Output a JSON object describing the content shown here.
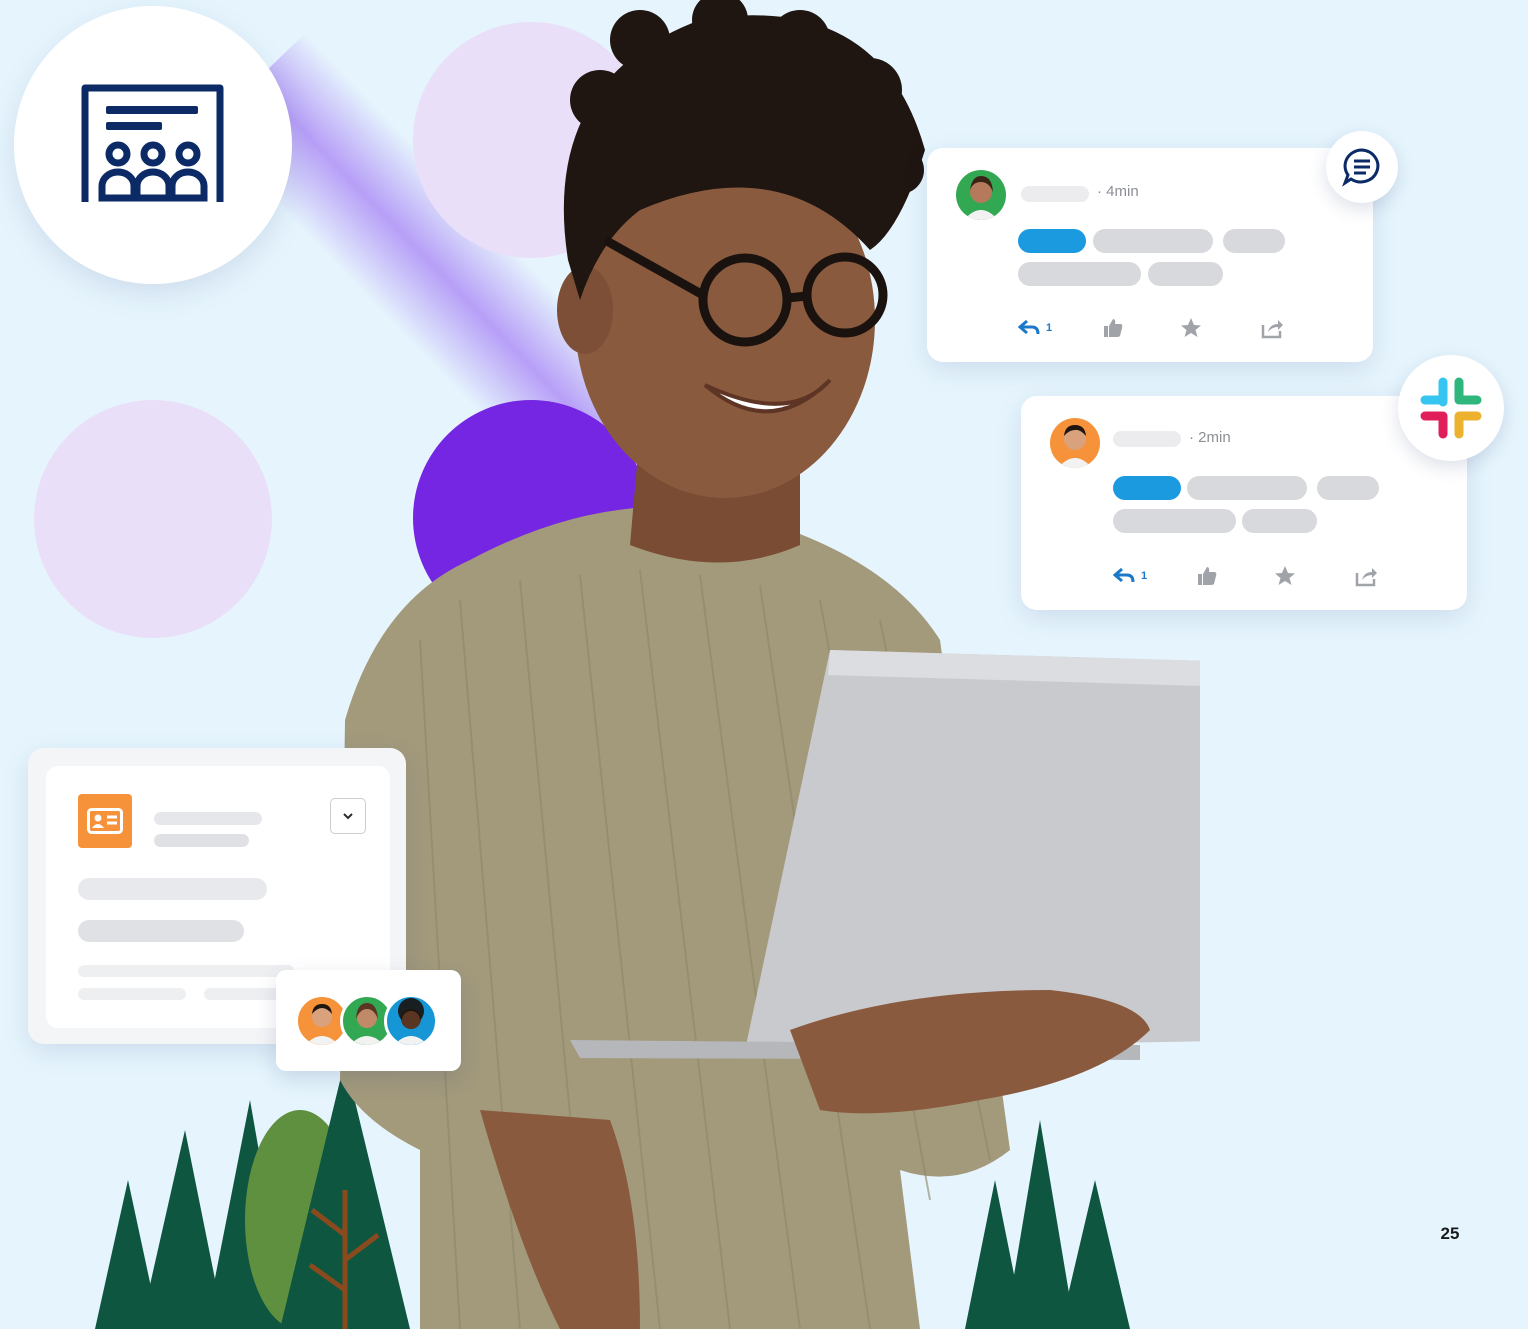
{
  "colors": {
    "background": "#e6f5fd",
    "lavender": "#e9dff8",
    "purple": "#7526e3",
    "navy": "#0b2a66",
    "blue": "#1c9ae0",
    "orange": "#f5923a",
    "green": "#33a853",
    "teal": "#1796d6",
    "tree_dark": "#0e5640",
    "tree_light": "#5e9040",
    "shirt": "#a39a7c",
    "laptop": "#c9cacd",
    "skin": "#8a5a3e",
    "hair": "#1f1511"
  },
  "icons": {
    "webinar": "webinar-audience-icon",
    "chat": "chat-bubble-icon",
    "slack": "slack-logo",
    "contact": "contact-card-icon",
    "dropdown": "chevron-down-icon",
    "reply": "reply-icon",
    "like": "thumbs-up-icon",
    "star": "star-icon",
    "share": "share-icon"
  },
  "posts": [
    {
      "time": "· 4min",
      "reply_count": "1",
      "avatar": "woman-green-avatar"
    },
    {
      "time": "· 2min",
      "reply_count": "1",
      "avatar": "man-orange-avatar"
    }
  ],
  "team_avatars": [
    "man-orange-avatar",
    "woman-green-avatar",
    "woman-blue-avatar"
  ],
  "page_number": "25"
}
